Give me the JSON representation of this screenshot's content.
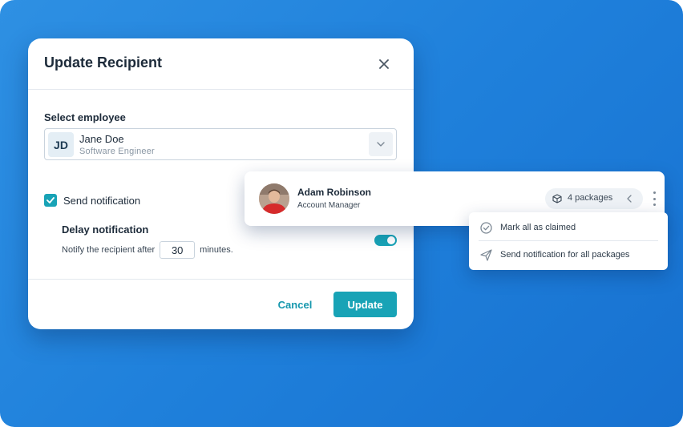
{
  "modal": {
    "title": "Update Recipient",
    "select_label": "Select employee",
    "employee": {
      "initials": "JD",
      "name": "Jane Doe",
      "role": "Software Engineer"
    },
    "send_notification_label": "Send notification",
    "send_notification_checked": true,
    "delay_title": "Delay notification",
    "delay_prefix": "Notify the recipient after",
    "delay_value": "30",
    "delay_suffix": "minutes.",
    "delay_enabled": true,
    "cancel_label": "Cancel",
    "update_label": "Update"
  },
  "recipient_card": {
    "name": "Adam Robinson",
    "role": "Account Manager",
    "packages_label": "4 packages"
  },
  "menu": {
    "items": [
      {
        "label": "Mark all as claimed",
        "icon": "check-circle-icon"
      },
      {
        "label": "Send notification for all packages",
        "icon": "send-icon"
      }
    ]
  },
  "colors": {
    "accent": "#18a3b6",
    "background": "#1f80db"
  }
}
